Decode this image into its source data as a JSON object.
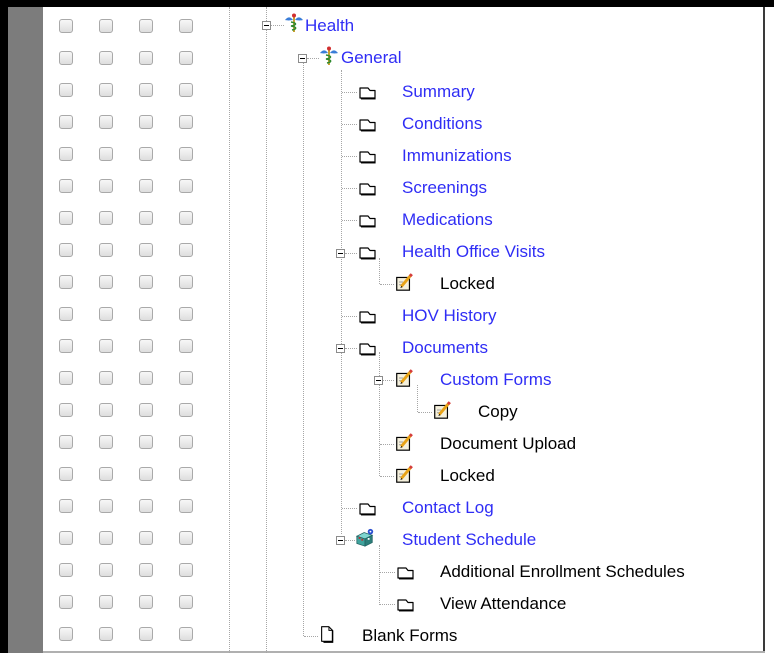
{
  "tree": {
    "health": {
      "label": "Health",
      "icon": "caduceus-icon"
    },
    "general": {
      "label": "General",
      "icon": "caduceus-icon"
    },
    "summary": {
      "label": "Summary",
      "icon": "tab-folder-icon"
    },
    "conditions": {
      "label": "Conditions",
      "icon": "tab-folder-icon"
    },
    "immunizations": {
      "label": "Immunizations",
      "icon": "tab-folder-icon"
    },
    "screenings": {
      "label": "Screenings",
      "icon": "tab-folder-icon"
    },
    "medications": {
      "label": "Medications",
      "icon": "tab-folder-icon"
    },
    "health_office_visits": {
      "label": "Health Office Visits",
      "icon": "tab-folder-icon"
    },
    "hov_locked": {
      "label": "Locked",
      "icon": "edit-form-icon"
    },
    "hov_history": {
      "label": "HOV History",
      "icon": "tab-folder-icon"
    },
    "documents": {
      "label": "Documents",
      "icon": "tab-folder-icon"
    },
    "custom_forms": {
      "label": "Custom Forms",
      "icon": "edit-form-icon"
    },
    "copy": {
      "label": "Copy",
      "icon": "edit-form-icon"
    },
    "document_upload": {
      "label": "Document Upload",
      "icon": "edit-form-icon"
    },
    "documents_locked": {
      "label": "Locked",
      "icon": "edit-form-icon"
    },
    "contact_log": {
      "label": "Contact Log",
      "icon": "tab-folder-icon"
    },
    "student_schedule": {
      "label": "Student Schedule",
      "icon": "schedule-blocks-icon"
    },
    "additional_enrollment_schedules": {
      "label": "Additional Enrollment Schedules",
      "icon": "tab-folder-icon"
    },
    "view_attendance": {
      "label": "View Attendance",
      "icon": "tab-folder-icon"
    },
    "blank_forms": {
      "label": "Blank Forms",
      "icon": "blank-page-icon"
    }
  },
  "colors": {
    "link": "#2f2df5",
    "text": "#000000",
    "gray_column": "#7c7c7c"
  }
}
